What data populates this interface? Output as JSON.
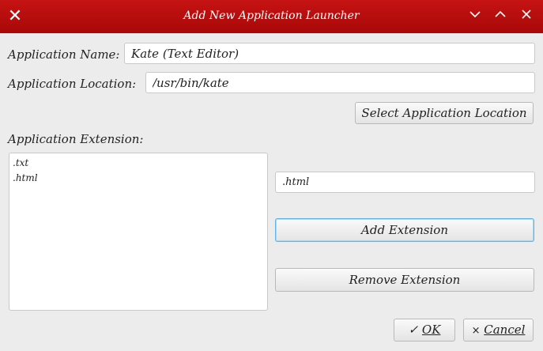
{
  "window": {
    "title": "Add New Application Launcher",
    "close_left_icon": "x-icon",
    "min_icon": "chevron-down-icon",
    "max_icon": "chevron-up-icon",
    "close_icon": "close-icon"
  },
  "form": {
    "app_name_label": "Application Name:",
    "app_name_value": "Kate (Text Editor)",
    "app_location_label": "Application Location:",
    "app_location_value": "/usr/bin/kate",
    "select_location_button": "Select Application Location",
    "extension_label": "Application Extension:",
    "extensions": [
      ".txt",
      ".html"
    ],
    "extension_input_value": ".html",
    "add_extension_button": "Add Extension",
    "remove_extension_button": "Remove Extension"
  },
  "footer": {
    "ok_icon": "checkmark-icon",
    "ok_label": "OK",
    "cancel_icon": "x-icon",
    "cancel_label": "Cancel"
  },
  "colors": {
    "titlebar": "#b50d0d",
    "focus_border": "#5fb3e6"
  }
}
